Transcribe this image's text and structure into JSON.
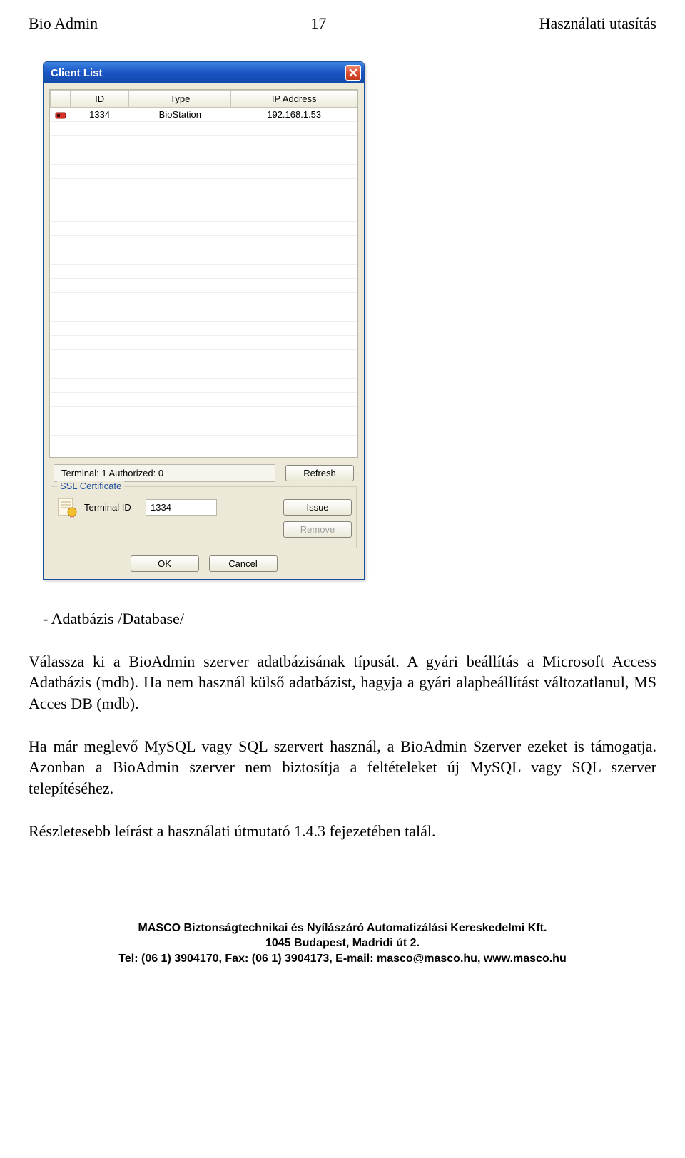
{
  "page": {
    "header_left": "Bio Admin",
    "header_center": "17",
    "header_right": "Használati utasítás"
  },
  "dialog": {
    "title": "Client List",
    "columns": [
      "ID",
      "Type",
      "IP Address"
    ],
    "rows": [
      {
        "id": "1334",
        "type": "BioStation",
        "ip": "192.168.1.53"
      }
    ],
    "status_line": "Terminal: 1  Authorized: 0",
    "refresh_btn": "Refresh",
    "ssl_heading": "SSL Certificate",
    "terminal_id_label": "Terminal ID",
    "terminal_id_value": "1334",
    "issue_btn": "Issue",
    "remove_btn": "Remove",
    "ok_btn": "OK",
    "cancel_btn": "Cancel"
  },
  "body": {
    "bullet_lead": "-   Adatbázis /Database/",
    "para1": "Válassza ki a BioAdmin szerver adatbázisának típusát. A gyári beállítás a Microsoft Access Adatbázis (mdb). Ha nem használ külső adatbázist, hagyja a gyári alapbeállítást változatlanul, MS Acces DB (mdb).",
    "para2": "Ha már meglevő MySQL vagy SQL szervert használ, a BioAdmin Szerver ezeket is támogatja. Azonban a BioAdmin szerver nem biztosítja a feltételeket új MySQL vagy SQL szerver telepítéséhez.",
    "para3": "Részletesebb leírást a használati útmutató 1.4.3 fejezetében talál."
  },
  "footer": {
    "line1": "MASCO Biztonságtechnikai és Nyílászáró Automatizálási Kereskedelmi Kft.",
    "line2": "1045 Budapest, Madridi út 2.",
    "line3": "Tel: (06 1) 3904170, Fax: (06 1) 3904173, E-mail: masco@masco.hu, www.masco.hu"
  }
}
